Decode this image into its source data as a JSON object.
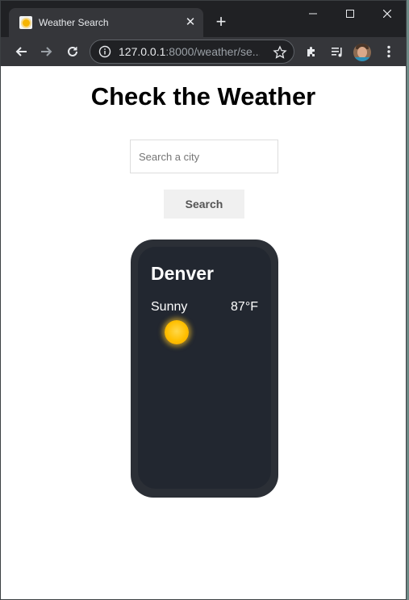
{
  "browser": {
    "tab_title": "Weather Search",
    "url_host": "127.0.0.1",
    "url_rest": ":8000/weather/se..."
  },
  "page": {
    "title": "Check the Weather",
    "search": {
      "placeholder": "Search a city",
      "value": "",
      "button_label": "Search"
    },
    "card": {
      "city": "Denver",
      "condition": "Sunny",
      "temperature": "87°F",
      "icon": "sun-icon"
    }
  }
}
